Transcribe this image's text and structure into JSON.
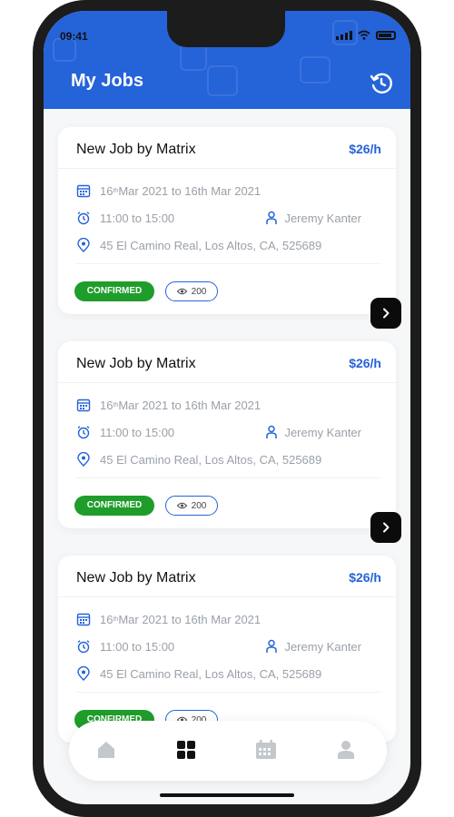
{
  "status_bar": {
    "time": "09:41"
  },
  "header": {
    "title": "My Jobs",
    "history_icon": "history-icon"
  },
  "jobs": [
    {
      "title": "New Job by Matrix",
      "rate": "$26/h",
      "date_start_day": "16",
      "date_suffix": "th",
      "date_rest": " Mar 2021 to 16th Mar 2021",
      "time": "11:00 to 15:00",
      "person": "Jeremy Kanter",
      "address": "45 El Camino Real, Los Altos, CA, 525689",
      "status": "CONFIRMED",
      "views": "200"
    },
    {
      "title": "New Job by Matrix",
      "rate": "$26/h",
      "date_start_day": "16",
      "date_suffix": "th",
      "date_rest": " Mar 2021 to 16th Mar 2021",
      "time": "11:00 to 15:00",
      "person": "Jeremy Kanter",
      "address": "45 El Camino Real, Los Altos, CA, 525689",
      "status": "CONFIRMED",
      "views": "200"
    },
    {
      "title": "New Job by Matrix",
      "rate": "$26/h",
      "date_start_day": "16",
      "date_suffix": "th",
      "date_rest": " Mar 2021 to 16th Mar 2021",
      "time": "11:00 to 15:00",
      "person": "Jeremy Kanter",
      "address": "45 El Camino Real, Los Altos, CA, 525689",
      "status": "CONFIRMED",
      "views": "200"
    }
  ],
  "nav": {
    "items": [
      "home-icon",
      "grid-icon",
      "calendar-icon",
      "profile-icon"
    ],
    "active": "grid-icon"
  },
  "colors": {
    "accent": "#2563d9",
    "confirmed": "#1f9d2b",
    "muted_text": "#9aa0a8"
  }
}
